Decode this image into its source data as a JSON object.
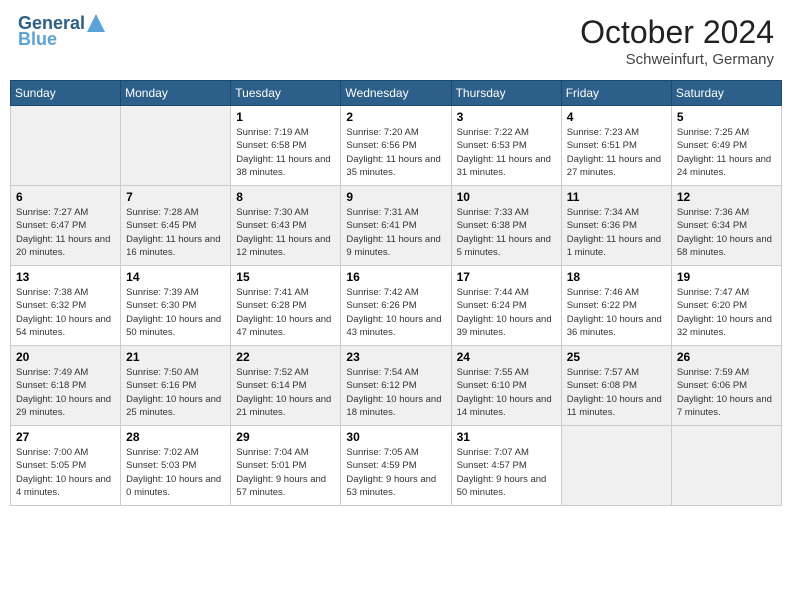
{
  "header": {
    "logo_line1": "General",
    "logo_line2": "Blue",
    "month": "October 2024",
    "location": "Schweinfurt, Germany"
  },
  "days_of_week": [
    "Sunday",
    "Monday",
    "Tuesday",
    "Wednesday",
    "Thursday",
    "Friday",
    "Saturday"
  ],
  "weeks": [
    [
      {
        "day": "",
        "info": ""
      },
      {
        "day": "",
        "info": ""
      },
      {
        "day": "1",
        "info": "Sunrise: 7:19 AM\nSunset: 6:58 PM\nDaylight: 11 hours and 38 minutes."
      },
      {
        "day": "2",
        "info": "Sunrise: 7:20 AM\nSunset: 6:56 PM\nDaylight: 11 hours and 35 minutes."
      },
      {
        "day": "3",
        "info": "Sunrise: 7:22 AM\nSunset: 6:53 PM\nDaylight: 11 hours and 31 minutes."
      },
      {
        "day": "4",
        "info": "Sunrise: 7:23 AM\nSunset: 6:51 PM\nDaylight: 11 hours and 27 minutes."
      },
      {
        "day": "5",
        "info": "Sunrise: 7:25 AM\nSunset: 6:49 PM\nDaylight: 11 hours and 24 minutes."
      }
    ],
    [
      {
        "day": "6",
        "info": "Sunrise: 7:27 AM\nSunset: 6:47 PM\nDaylight: 11 hours and 20 minutes."
      },
      {
        "day": "7",
        "info": "Sunrise: 7:28 AM\nSunset: 6:45 PM\nDaylight: 11 hours and 16 minutes."
      },
      {
        "day": "8",
        "info": "Sunrise: 7:30 AM\nSunset: 6:43 PM\nDaylight: 11 hours and 12 minutes."
      },
      {
        "day": "9",
        "info": "Sunrise: 7:31 AM\nSunset: 6:41 PM\nDaylight: 11 hours and 9 minutes."
      },
      {
        "day": "10",
        "info": "Sunrise: 7:33 AM\nSunset: 6:38 PM\nDaylight: 11 hours and 5 minutes."
      },
      {
        "day": "11",
        "info": "Sunrise: 7:34 AM\nSunset: 6:36 PM\nDaylight: 11 hours and 1 minute."
      },
      {
        "day": "12",
        "info": "Sunrise: 7:36 AM\nSunset: 6:34 PM\nDaylight: 10 hours and 58 minutes."
      }
    ],
    [
      {
        "day": "13",
        "info": "Sunrise: 7:38 AM\nSunset: 6:32 PM\nDaylight: 10 hours and 54 minutes."
      },
      {
        "day": "14",
        "info": "Sunrise: 7:39 AM\nSunset: 6:30 PM\nDaylight: 10 hours and 50 minutes."
      },
      {
        "day": "15",
        "info": "Sunrise: 7:41 AM\nSunset: 6:28 PM\nDaylight: 10 hours and 47 minutes."
      },
      {
        "day": "16",
        "info": "Sunrise: 7:42 AM\nSunset: 6:26 PM\nDaylight: 10 hours and 43 minutes."
      },
      {
        "day": "17",
        "info": "Sunrise: 7:44 AM\nSunset: 6:24 PM\nDaylight: 10 hours and 39 minutes."
      },
      {
        "day": "18",
        "info": "Sunrise: 7:46 AM\nSunset: 6:22 PM\nDaylight: 10 hours and 36 minutes."
      },
      {
        "day": "19",
        "info": "Sunrise: 7:47 AM\nSunset: 6:20 PM\nDaylight: 10 hours and 32 minutes."
      }
    ],
    [
      {
        "day": "20",
        "info": "Sunrise: 7:49 AM\nSunset: 6:18 PM\nDaylight: 10 hours and 29 minutes."
      },
      {
        "day": "21",
        "info": "Sunrise: 7:50 AM\nSunset: 6:16 PM\nDaylight: 10 hours and 25 minutes."
      },
      {
        "day": "22",
        "info": "Sunrise: 7:52 AM\nSunset: 6:14 PM\nDaylight: 10 hours and 21 minutes."
      },
      {
        "day": "23",
        "info": "Sunrise: 7:54 AM\nSunset: 6:12 PM\nDaylight: 10 hours and 18 minutes."
      },
      {
        "day": "24",
        "info": "Sunrise: 7:55 AM\nSunset: 6:10 PM\nDaylight: 10 hours and 14 minutes."
      },
      {
        "day": "25",
        "info": "Sunrise: 7:57 AM\nSunset: 6:08 PM\nDaylight: 10 hours and 11 minutes."
      },
      {
        "day": "26",
        "info": "Sunrise: 7:59 AM\nSunset: 6:06 PM\nDaylight: 10 hours and 7 minutes."
      }
    ],
    [
      {
        "day": "27",
        "info": "Sunrise: 7:00 AM\nSunset: 5:05 PM\nDaylight: 10 hours and 4 minutes."
      },
      {
        "day": "28",
        "info": "Sunrise: 7:02 AM\nSunset: 5:03 PM\nDaylight: 10 hours and 0 minutes."
      },
      {
        "day": "29",
        "info": "Sunrise: 7:04 AM\nSunset: 5:01 PM\nDaylight: 9 hours and 57 minutes."
      },
      {
        "day": "30",
        "info": "Sunrise: 7:05 AM\nSunset: 4:59 PM\nDaylight: 9 hours and 53 minutes."
      },
      {
        "day": "31",
        "info": "Sunrise: 7:07 AM\nSunset: 4:57 PM\nDaylight: 9 hours and 50 minutes."
      },
      {
        "day": "",
        "info": ""
      },
      {
        "day": "",
        "info": ""
      }
    ]
  ]
}
